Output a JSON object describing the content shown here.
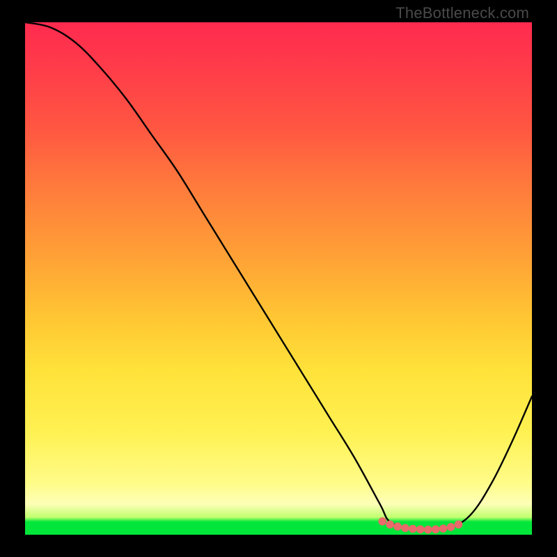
{
  "watermark": "TheBottleneck.com",
  "chart_data": {
    "type": "line",
    "title": "",
    "xlabel": "",
    "ylabel": "",
    "xlim": [
      0,
      100
    ],
    "ylim": [
      0,
      100
    ],
    "series": [
      {
        "name": "bottleneck-curve",
        "x": [
          0,
          5,
          10,
          15,
          20,
          25,
          30,
          35,
          40,
          45,
          50,
          55,
          60,
          65,
          70,
          72,
          76,
          80,
          84,
          88,
          92,
          96,
          100
        ],
        "values": [
          100,
          99,
          96,
          91,
          85,
          78,
          71,
          63,
          55,
          47,
          39,
          31,
          23,
          15,
          6,
          2.5,
          1.2,
          1.0,
          1.4,
          4,
          10,
          18,
          27
        ]
      }
    ],
    "markers": {
      "name": "highlight-dots",
      "x": [
        70.5,
        72.0,
        73.5,
        75.0,
        76.5,
        78.0,
        79.5,
        81.0,
        82.5,
        84.0,
        85.5
      ],
      "values": [
        2.6,
        2.0,
        1.6,
        1.3,
        1.15,
        1.05,
        1.0,
        1.05,
        1.2,
        1.5,
        2.0
      ]
    },
    "colors": {
      "curve": "#000000",
      "marker": "#e86a6a"
    }
  }
}
